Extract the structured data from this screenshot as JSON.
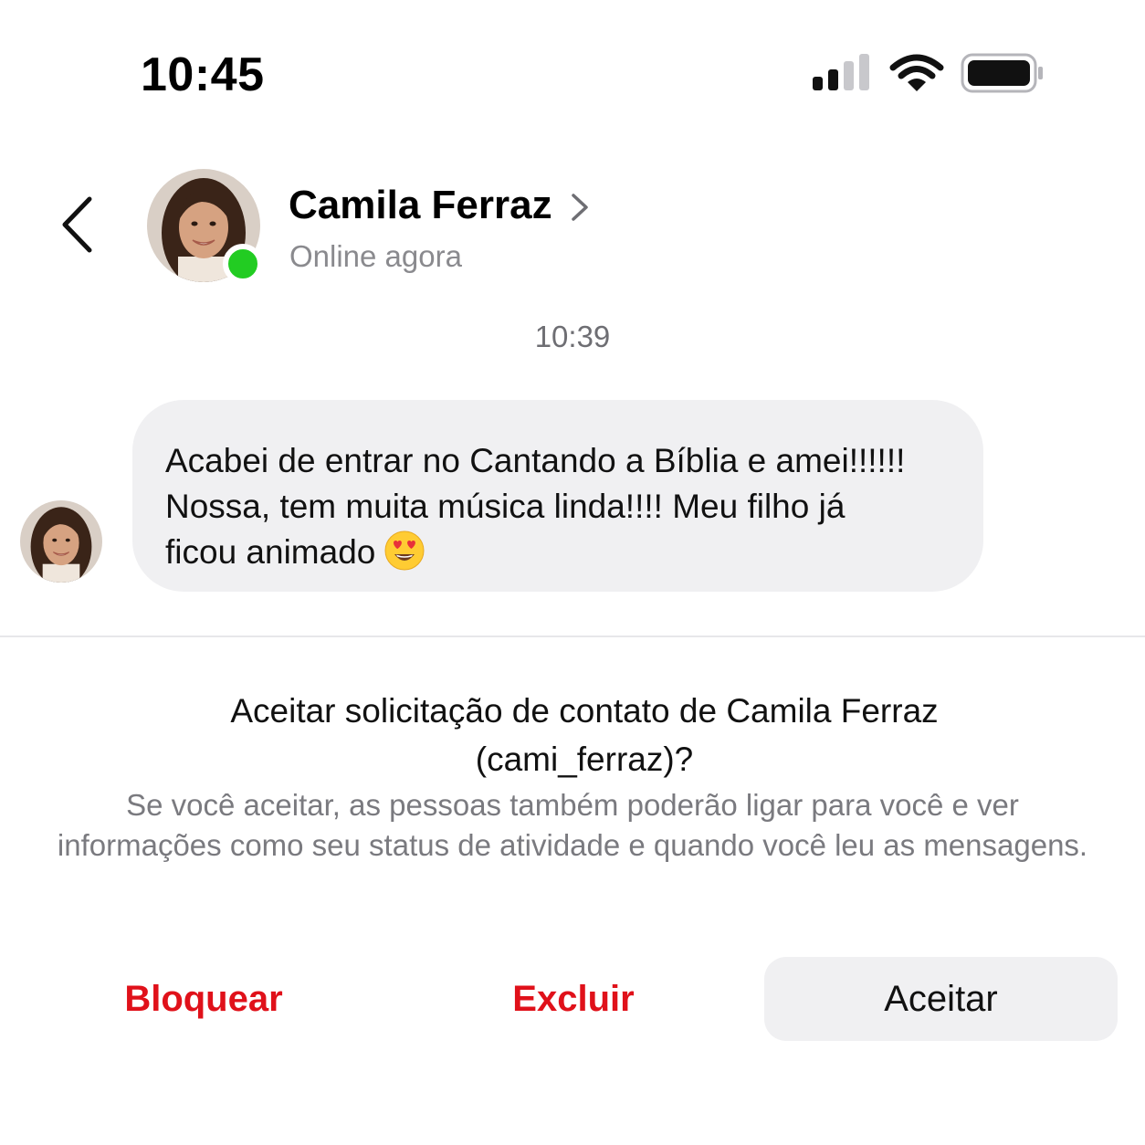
{
  "status_bar": {
    "time": "10:45"
  },
  "header": {
    "contact_name": "Camila Ferraz",
    "status": "Online agora"
  },
  "conversation": {
    "timestamp": "10:39",
    "message": {
      "text_line1": "Acabei de entrar no Cantando a Bíblia e amei!!!!!!",
      "text_line2": "Nossa, tem muita música linda!!!! Meu filho já",
      "text_line3": "ficou animado",
      "emoji": "heart-eyes-emoji"
    }
  },
  "request": {
    "title": "Aceitar solicitação de contato de Camila Ferraz (cami_ferraz)?",
    "description": "Se você aceitar, as pessoas também poderão ligar para você e ver informações como seu status de atividade e quando você leu as mensagens."
  },
  "actions": {
    "block_label": "Bloquear",
    "delete_label": "Excluir",
    "accept_label": "Aceitar"
  },
  "colors": {
    "online": "#22cc22",
    "destructive": "#e0111a",
    "bubble": "#f0f0f2"
  }
}
